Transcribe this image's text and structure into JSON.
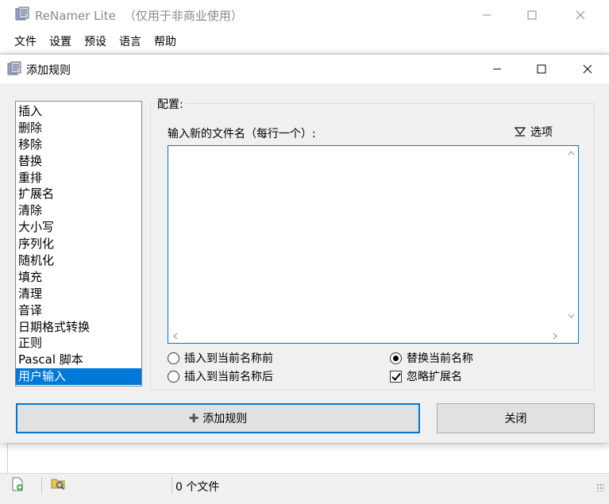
{
  "main_window": {
    "title": "ReNamer Lite",
    "title_suffix": "（仅用于非商业使用）",
    "menu": [
      "文件",
      "设置",
      "预设",
      "语言",
      "帮助"
    ],
    "status": {
      "file_count": "0 个文件"
    }
  },
  "dialog": {
    "title": "添加规则",
    "rules": [
      "插入",
      "删除",
      "移除",
      "替换",
      "重排",
      "扩展名",
      "清除",
      "大小写",
      "序列化",
      "随机化",
      "填充",
      "清理",
      "音译",
      "日期格式转换",
      "正则",
      "Pascal 脚本",
      "用户输入"
    ],
    "selected_rule": "用户输入",
    "config": {
      "group_label": "配置:",
      "field_label": "输入新的文件名（每行一个）:",
      "options_label": "选项",
      "input_value": "",
      "radio_insert_before": "插入到当前名称前",
      "radio_insert_after": "插入到当前名称后",
      "radio_replace": "替换当前名称",
      "radio_selected": "替换当前名称",
      "checkbox_ignore_ext": "忽略扩展名",
      "checkbox_ignore_ext_checked": true
    },
    "buttons": {
      "add_rule": "添加规则",
      "close": "关闭"
    }
  },
  "colors": {
    "accent": "#0078d7",
    "selection": "#0078d7"
  },
  "icons": [
    "renamer-app-icon",
    "minimize-icon",
    "maximize-icon",
    "close-icon",
    "filter-icon",
    "plus-icon",
    "add-file-icon",
    "add-folder-icon",
    "size-grip-icon"
  ]
}
